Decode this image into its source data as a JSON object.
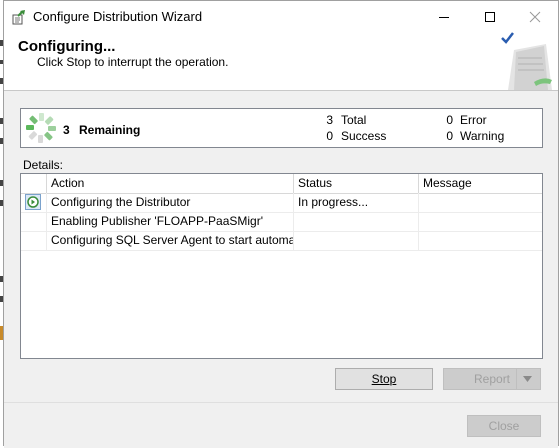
{
  "window": {
    "title": "Configure Distribution Wizard"
  },
  "header": {
    "title": "Configuring...",
    "subtitle": "Click Stop to interrupt the operation."
  },
  "progress": {
    "remaining_count": "3",
    "remaining_label": "Remaining",
    "total_count": "3",
    "total_label": "Total",
    "success_count": "0",
    "success_label": "Success",
    "error_count": "0",
    "error_label": "Error",
    "warning_count": "0",
    "warning_label": "Warning"
  },
  "details": {
    "label": "Details:",
    "columns": [
      "Action",
      "Status",
      "Message"
    ],
    "rows": [
      {
        "action": "Configuring the Distributor",
        "status": "In progress...",
        "message": ""
      },
      {
        "action": "Enabling Publisher 'FLOAPP-PaaSMigr'",
        "status": "",
        "message": ""
      },
      {
        "action": "Configuring SQL Server Agent to start automati...",
        "status": "",
        "message": ""
      }
    ]
  },
  "buttons": {
    "stop": "Stop",
    "report": "Report",
    "close": "Close"
  },
  "colors": {
    "spinner_green": "#5cb85c",
    "header_bg": "#ffffff",
    "dialog_bg": "#f0f0f0"
  }
}
